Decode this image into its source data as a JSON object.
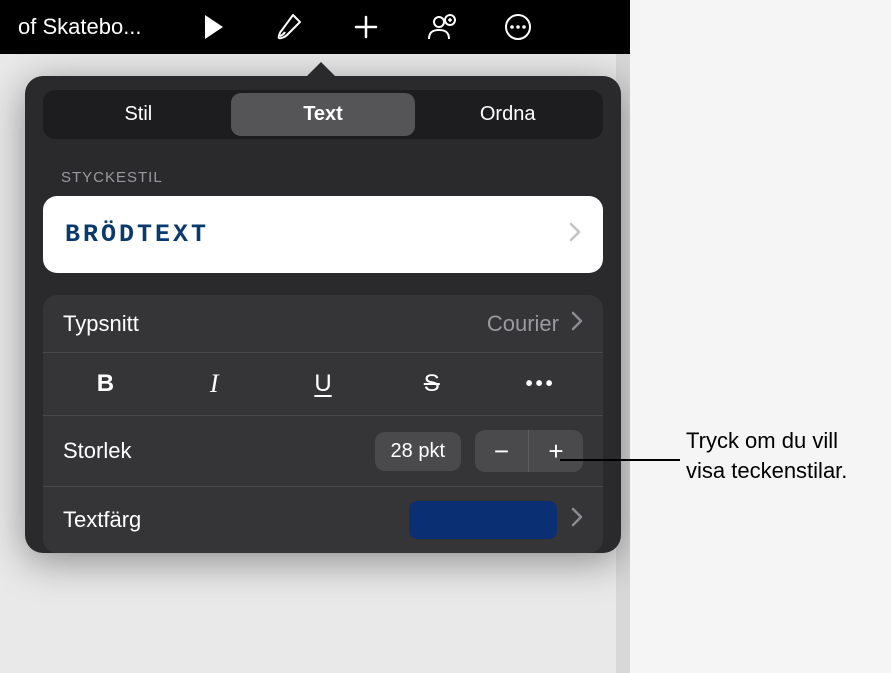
{
  "toolbar": {
    "doc_title": "of Skatebo..."
  },
  "tabs": {
    "style": "Stil",
    "text": "Text",
    "arrange": "Ordna"
  },
  "paragraph": {
    "section_label": "STYCKESTIL",
    "style_name": "BRÖDTEXT"
  },
  "font": {
    "label": "Typsnitt",
    "value": "Courier"
  },
  "format": {
    "bold": "B",
    "italic": "I",
    "underline": "U",
    "strike": "S",
    "more": "•••"
  },
  "size": {
    "label": "Storlek",
    "value": "28 pkt",
    "minus": "−",
    "plus": "+"
  },
  "color": {
    "label": "Textfärg",
    "swatch": "#0b2f73"
  },
  "callout": {
    "line1": "Tryck om du vill",
    "line2": "visa teckenstilar."
  }
}
